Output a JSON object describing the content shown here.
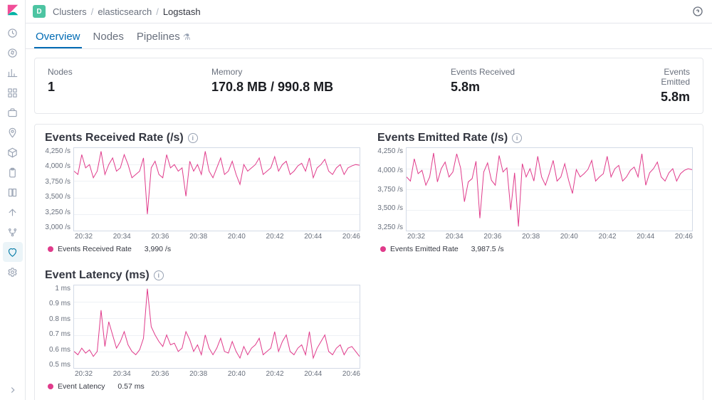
{
  "branding": {
    "space_letter": "D"
  },
  "breadcrumbs": {
    "a": "Clusters",
    "b": "elasticsearch",
    "c": "Logstash"
  },
  "tabs": {
    "overview": "Overview",
    "nodes": "Nodes",
    "pipelines": "Pipelines"
  },
  "summary": {
    "nodes_label": "Nodes",
    "nodes_value": "1",
    "memory_label": "Memory",
    "memory_value": "170.8 MB / 990.8 MB",
    "received_label": "Events Received",
    "received_value": "5.8m",
    "emitted_label": "Events Emitted",
    "emitted_value": "5.8m"
  },
  "xticks": [
    "20:32",
    "20:34",
    "20:36",
    "20:38",
    "20:40",
    "20:42",
    "20:44",
    "20:46"
  ],
  "chart_data": [
    {
      "id": "events_received_rate",
      "type": "line",
      "title": "Events Received Rate (/s)",
      "xlabel": "",
      "ylabel": "",
      "ylim": [
        3000,
        4250
      ],
      "yunit": "/s",
      "yticks": [
        4250,
        4000,
        3750,
        3500,
        3250,
        3000
      ],
      "x_categories": [
        "20:32",
        "20:34",
        "20:36",
        "20:38",
        "20:40",
        "20:42",
        "20:44",
        "20:46"
      ],
      "series": [
        {
          "name": "Events Received Rate",
          "legend_value": "3,990 /s",
          "color": "#e03b8b",
          "values": [
            3900,
            3850,
            4150,
            3950,
            4000,
            3800,
            3900,
            4200,
            3850,
            4000,
            4100,
            3900,
            3950,
            4150,
            4000,
            3800,
            3850,
            3900,
            4100,
            3250,
            3950,
            4050,
            3850,
            3800,
            4150,
            3950,
            4000,
            3900,
            3950,
            3520,
            4050,
            3900,
            4000,
            3850,
            4200,
            3900,
            3800,
            3950,
            4100,
            3850,
            3900,
            4050,
            3850,
            3700,
            4000,
            3900,
            3950,
            4000,
            4100,
            3850,
            3900,
            3950,
            4120,
            3900,
            4000,
            4050,
            3850,
            3900,
            3980,
            4020,
            3900,
            4100,
            3800,
            3950,
            4000,
            4080,
            3900,
            3850,
            3950,
            4000,
            3850,
            3950,
            3980,
            4000,
            3990
          ]
        }
      ]
    },
    {
      "id": "events_emitted_rate",
      "type": "line",
      "title": "Events Emitted Rate (/s)",
      "xlabel": "",
      "ylabel": "",
      "ylim": [
        3250,
        4250
      ],
      "yunit": "/s",
      "yticks": [
        4250,
        4000,
        3750,
        3500,
        3250
      ],
      "x_categories": [
        "20:32",
        "20:34",
        "20:36",
        "20:38",
        "20:40",
        "20:42",
        "20:44",
        "20:46"
      ],
      "series": [
        {
          "name": "Events Emitted Rate",
          "legend_value": "3,987.5 /s",
          "color": "#e03b8b",
          "values": [
            3900,
            3850,
            4120,
            3940,
            3980,
            3800,
            3900,
            4190,
            3840,
            4000,
            4080,
            3900,
            3960,
            4180,
            4010,
            3600,
            3840,
            3880,
            4090,
            3400,
            3960,
            4070,
            3860,
            3800,
            4160,
            3960,
            4010,
            3500,
            3950,
            3300,
            4060,
            3900,
            4000,
            3850,
            4150,
            3900,
            3800,
            3940,
            4100,
            3850,
            3900,
            4060,
            3860,
            3700,
            3990,
            3900,
            3940,
            3990,
            4100,
            3850,
            3900,
            3940,
            4150,
            3900,
            4000,
            4040,
            3850,
            3900,
            3980,
            4020,
            3900,
            4180,
            3800,
            3950,
            4000,
            4080,
            3900,
            3850,
            3950,
            4000,
            3850,
            3940,
            3980,
            4000,
            3988
          ]
        }
      ]
    },
    {
      "id": "event_latency",
      "type": "line",
      "title": "Event Latency (ms)",
      "xlabel": "",
      "ylabel": "",
      "ylim": [
        0.5,
        1.0
      ],
      "yunit": "ms",
      "yticks": [
        1,
        0.9,
        0.8,
        0.7,
        0.6,
        0.5
      ],
      "x_categories": [
        "20:32",
        "20:34",
        "20:36",
        "20:38",
        "20:40",
        "20:42",
        "20:44",
        "20:46"
      ],
      "series": [
        {
          "name": "Event Latency",
          "legend_value": "0.57 ms",
          "color": "#e03b8b",
          "values": [
            0.6,
            0.58,
            0.62,
            0.59,
            0.61,
            0.57,
            0.6,
            0.85,
            0.63,
            0.78,
            0.7,
            0.62,
            0.66,
            0.72,
            0.64,
            0.6,
            0.58,
            0.61,
            0.68,
            0.98,
            0.75,
            0.7,
            0.66,
            0.63,
            0.7,
            0.64,
            0.65,
            0.6,
            0.62,
            0.72,
            0.67,
            0.6,
            0.64,
            0.58,
            0.7,
            0.62,
            0.58,
            0.62,
            0.68,
            0.6,
            0.59,
            0.66,
            0.6,
            0.56,
            0.63,
            0.58,
            0.62,
            0.64,
            0.68,
            0.58,
            0.6,
            0.62,
            0.72,
            0.6,
            0.66,
            0.7,
            0.6,
            0.58,
            0.62,
            0.64,
            0.58,
            0.72,
            0.56,
            0.62,
            0.66,
            0.7,
            0.6,
            0.58,
            0.62,
            0.64,
            0.58,
            0.62,
            0.63,
            0.6,
            0.57
          ]
        }
      ]
    }
  ],
  "rail_icons": [
    "clock",
    "compass",
    "bar-chart",
    "grid",
    "briefcase",
    "pin",
    "cube",
    "clipboard",
    "flip",
    "arrow-up",
    "fork",
    "heart",
    "gear"
  ],
  "active_rail_index": 11
}
